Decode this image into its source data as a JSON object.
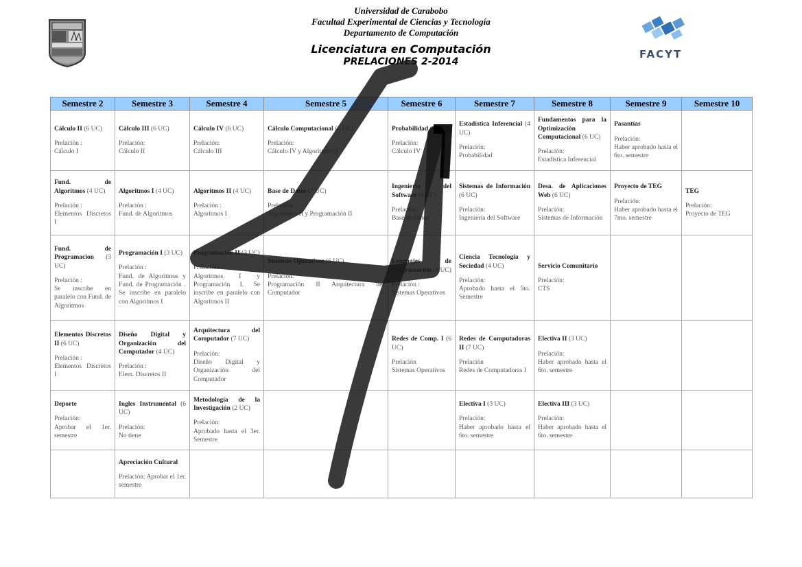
{
  "header": {
    "line1": "Universidad de Carabobo",
    "line2": "Facultad Experimental de Ciencias y Tecnología",
    "line3": "Departamento de Computación",
    "title": "Licenciatura en Computación",
    "subtitle": "PRELACIONES 2-2014"
  },
  "logos": {
    "right_label": "FACYT"
  },
  "colors": {
    "header_bg": "#99ccff",
    "grid_border": "#a8a8a8",
    "scribble": "#1a1a1a"
  },
  "columns": [
    "Semestre 2",
    "Semestre 3",
    "Semestre 4",
    "Semestre 5",
    "Semestre 6",
    "Semestre 7",
    "Semestre 8",
    "Semestre 9",
    "Semestre 10"
  ],
  "rows": [
    [
      {
        "name": "Cálculo II",
        "uc": "(6 UC)",
        "pre": "Prelación :",
        "val": "Cálculo I"
      },
      {
        "name": "Cálculo III",
        "uc": "(6 UC)",
        "pre": "Prelación:",
        "val": "Cálculo II"
      },
      {
        "name": "Cálculo IV",
        "uc": "(6 UC)",
        "pre": "Prelación:",
        "val": "Cálculo III"
      },
      {
        "name": "Cálculo Computacional",
        "uc": "(6 UC)",
        "pre": "Prelación:",
        "val": "Cálculo IV y Algoritmos II"
      },
      {
        "name": "Probabilidad",
        "uc": "(4 UC)",
        "pre": "Prelación:",
        "val": "Cálculo IV"
      },
      {
        "name": "Estadística Inferencial",
        "uc": "(4 UC)",
        "pre": "Prelación:",
        "val": "Probabilidad"
      },
      {
        "name": "Fundamentos para la Optimización Computacional",
        "uc": "(6 UC)",
        "pre": "Prelación:",
        "val": "Estadística Inferencial"
      },
      {
        "name": "Pasantías",
        "uc": "",
        "pre": "Prelación:",
        "val": "Haber aprobado hasta el 6to. semestre"
      },
      {
        "name": "",
        "uc": "",
        "pre": "",
        "val": ""
      }
    ],
    [
      {
        "name": "Fund. de Algoritmos",
        "uc": "(4 UC)",
        "pre": "Prelación :",
        "val": "Elementos Discretos I"
      },
      {
        "name": "Algoritmos I",
        "uc": "(4 UC)",
        "pre": "Prelación :",
        "val": "Fund. de Algoritmos"
      },
      {
        "name": "Algoritmos II",
        "uc": "(4 UC)",
        "pre": "Prelación :",
        "val": "Algoritmos I"
      },
      {
        "name": "Base de Datos",
        "uc": "(7 UC)",
        "pre": "Prelación:",
        "val": "Algoritmos II y Programación II"
      },
      {
        "name": "Ingeniería del Software",
        "uc": "(4 UC)",
        "pre": "Prelación:",
        "val": "Base de Datos"
      },
      {
        "name": "Sistemas de Información",
        "uc": "(6 UC)",
        "pre": "Prelación:",
        "val": "Ingeniería del Software"
      },
      {
        "name": "Desa. de Aplicaciones Web",
        "uc": "(6 UC)",
        "pre": "Prelación:",
        "val": "Sistemas de Información"
      },
      {
        "name": "Proyecto de TEG",
        "uc": "",
        "pre": "Prelación:",
        "val": "Haber aprobado hasta el 7mo. semestre"
      },
      {
        "name": "TEG",
        "uc": "",
        "pre": "Prelación:",
        "val": "Proyecto de TEG"
      }
    ],
    [
      {
        "name": "Fund. de Programacion",
        "uc": "(3 UC)",
        "pre": "Prelación :",
        "val": "Se inscribe en paralelo con Fund. de Algoritmos"
      },
      {
        "name": "Programación I",
        "uc": "(3 UC)",
        "pre": "Prelación :",
        "val": "Fund. de Algoritmos y Fund. de Programación . Se inscribe en paralelo con Algoritmos I"
      },
      {
        "name": "Programación II",
        "uc": "(3 UC)",
        "pre": "Prelación:",
        "val": "Algoritmos I y Programación I. Se inscribe en paralelo con Algoritmos II"
      },
      {
        "name": "Sistemas Operativos",
        "uc": "(6 UC)",
        "pre": "Prelación:",
        "val": "Programación II Arquitectura del Computador"
      },
      {
        "name": "Lenguajes de Programación",
        "uc": "(4 UC)",
        "pre": "Prelación :",
        "val": "Sistemas Operativos"
      },
      {
        "name": "Ciencia Tecnología y Sociedad",
        "uc": "(4 UC)",
        "pre": "Prelación:",
        "val": "Aprobado hasta el 5to. Semestre"
      },
      {
        "name": "Servicio Comunitario",
        "uc": "",
        "pre": "Prelación:",
        "val": "CTS"
      },
      {
        "name": "",
        "uc": "",
        "pre": "",
        "val": ""
      },
      {
        "name": "",
        "uc": "",
        "pre": "",
        "val": ""
      }
    ],
    [
      {
        "name": "Elementos Discretos II",
        "uc": "(6 UC)",
        "pre": "Prelación :",
        "val": "Elementos Discretos I"
      },
      {
        "name": "Diseño Digital y Organización del Computador",
        "uc": "(4 UC)",
        "pre": "Prelación :",
        "val": "Elem. Discretos II"
      },
      {
        "name": "Arquitectura del Computador",
        "uc": "(7 UC)",
        "pre": "Prelación:",
        "val": "Diseño Digital y Organización del Computador"
      },
      {
        "name": "",
        "uc": "",
        "pre": "",
        "val": ""
      },
      {
        "name": "Redes de Comp. I",
        "uc": "(6 UC)",
        "pre": "Prelación",
        "val": "Sistemas Operativos"
      },
      {
        "name": "Redes de Computadoras II",
        "uc": "(7 UC)",
        "pre": "Prelación",
        "val": "Redes de Computadoras I"
      },
      {
        "name": "Electiva II",
        "uc": "(3 UC)",
        "pre": "Prelación:",
        "val": "Haber aprobado hasta el 6to. semestre"
      },
      {
        "name": "",
        "uc": "",
        "pre": "",
        "val": ""
      },
      {
        "name": "",
        "uc": "",
        "pre": "",
        "val": ""
      }
    ],
    [
      {
        "name": "Deporte",
        "uc": "",
        "pre": "Prelación:",
        "val": "Aprobar el 1er. semestre"
      },
      {
        "name": "Ingles Instrumental",
        "uc": "(6 UC)",
        "pre": "Prelación:",
        "val": "No tiene"
      },
      {
        "name": "Metodología de la Investigación",
        "uc": "(2 UC)",
        "pre": "Prelación:",
        "val": "Aprobado hasta el 3er. Semestre"
      },
      {
        "name": "",
        "uc": "",
        "pre": "",
        "val": ""
      },
      {
        "name": "",
        "uc": "",
        "pre": "",
        "val": ""
      },
      {
        "name": "Electiva I",
        "uc": "(3 UC)",
        "pre": "Prelación:",
        "val": "Haber aprobado hasta el 6to. semestre"
      },
      {
        "name": "Electiva III",
        "uc": "(3 UC)",
        "pre": "Prelación:",
        "val": "Haber aprobado hasta el 6to. semestre"
      },
      {
        "name": "",
        "uc": "",
        "pre": "",
        "val": ""
      },
      {
        "name": "",
        "uc": "",
        "pre": "",
        "val": ""
      }
    ],
    [
      {
        "name": "",
        "uc": "",
        "pre": "",
        "val": ""
      },
      {
        "name": "Apreciación Cultural",
        "uc": "",
        "pre": "Prelación: Aprobar el 1er. semestre",
        "val": ""
      },
      {
        "name": "",
        "uc": "",
        "pre": "",
        "val": ""
      },
      {
        "name": "",
        "uc": "",
        "pre": "",
        "val": ""
      },
      {
        "name": "",
        "uc": "",
        "pre": "",
        "val": ""
      },
      {
        "name": "",
        "uc": "",
        "pre": "",
        "val": ""
      },
      {
        "name": "",
        "uc": "",
        "pre": "",
        "val": ""
      },
      {
        "name": "",
        "uc": "",
        "pre": "",
        "val": ""
      },
      {
        "name": "",
        "uc": "",
        "pre": "",
        "val": ""
      }
    ]
  ]
}
